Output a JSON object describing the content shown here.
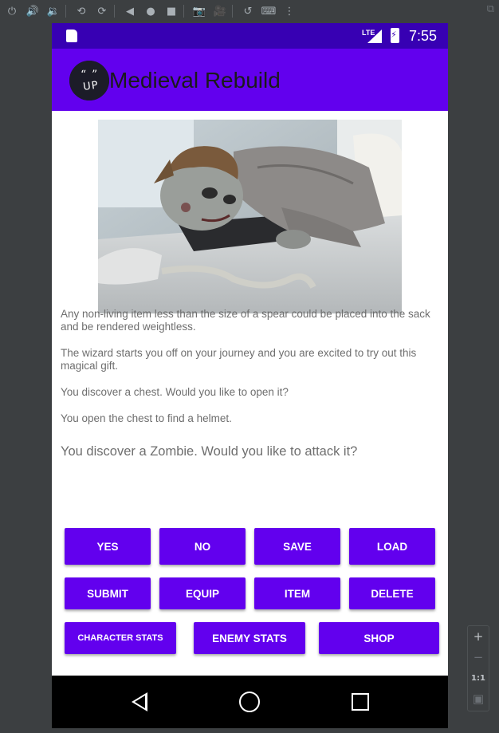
{
  "emulator": {
    "toolbar_icons": [
      "power-icon",
      "volume-up-icon",
      "volume-down-icon",
      "rotate-left-icon",
      "rotate-right-icon",
      "back-icon",
      "home-icon",
      "overview-icon",
      "camera-icon",
      "video-icon",
      "undo-icon",
      "keyboard-icon",
      "more-icon"
    ],
    "toolbar_glyphs": [
      "⏻",
      "🔊",
      "🔉",
      "⟲",
      "⟳",
      "◀",
      "●",
      "■",
      "📷",
      "🎥",
      "↺",
      "⌨",
      "⋮"
    ],
    "zoom": {
      "plus": "+",
      "minus": "−",
      "ratio": "1:1",
      "fit": "▣"
    }
  },
  "status_bar": {
    "network": "LTE",
    "time": "7:55"
  },
  "app_bar": {
    "logo_text": "“ ”\nUP",
    "title": "Medieval Rebuild"
  },
  "story": {
    "paragraphs": [
      "Any non-living item less than the size of a spear could be placed into the sack and be rendered weightless.",
      "The wizard starts you off on your journey and you are excited to try out this magical gift.",
      "You discover a chest. Would you like to open it?",
      "You open the chest to find a helmet."
    ],
    "question": "You discover a Zombie. Would you like to attack it?"
  },
  "buttons": {
    "yes": "YES",
    "no": "NO",
    "save": "SAVE",
    "load": "LOAD",
    "submit": "SUBMIT",
    "equip": "EQUIP",
    "item": "ITEM",
    "delete": "DELETE",
    "character_stats": "CHARACTER STATS",
    "enemy_stats": "ENEMY STATS",
    "shop": "SHOP"
  },
  "colors": {
    "primary": "#6200ee",
    "primary_dark": "#3700b3"
  }
}
